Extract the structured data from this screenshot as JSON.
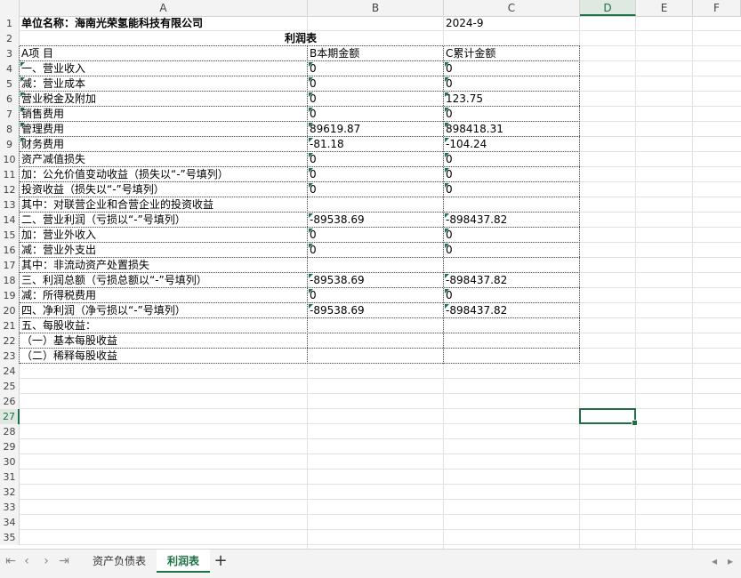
{
  "columns": [
    "A",
    "B",
    "C",
    "D",
    "E",
    "F"
  ],
  "selected_column": "D",
  "selected_row": "27",
  "rows": [
    {
      "n": "1",
      "a": "单位名称：海南光荣氢能科技有限公司",
      "b": "",
      "c": "2024-9"
    },
    {
      "n": "2",
      "title": "利润表"
    },
    {
      "n": "3",
      "a": "A项    目",
      "b": "B本期金额",
      "c": "C累计金额"
    },
    {
      "n": "4",
      "a": "一、营业收入",
      "b": "0",
      "c": "0"
    },
    {
      "n": "5",
      "a": "    减：营业成本",
      "b": "0",
      "c": "0"
    },
    {
      "n": "6",
      "a": "        营业税金及附加",
      "b": "0",
      "c": "123.75"
    },
    {
      "n": "7",
      "a": "        销售费用",
      "b": "0",
      "c": "0"
    },
    {
      "n": "8",
      "a": "        管理费用",
      "b": "89619.87",
      "c": "898418.31"
    },
    {
      "n": "9",
      "a": "        财务费用",
      "b": "-81.18",
      "c": "-104.24"
    },
    {
      "n": "10",
      "a": "        资产减值损失",
      "b": "0",
      "c": "0"
    },
    {
      "n": "11",
      "a": "        加：公允价值变动收益（损失以“-”号填列）",
      "b": "0",
      "c": "0"
    },
    {
      "n": "12",
      "a": "            投资收益（损失以“-”号填列）",
      "b": "0",
      "c": "0"
    },
    {
      "n": "13",
      "a": "            其中：对联营企业和合营企业的投资收益",
      "b": "",
      "c": ""
    },
    {
      "n": "14",
      "a": "二、营业利润（亏损以“-”号填列）",
      "b": "-89538.69",
      "c": "-898437.82"
    },
    {
      "n": "15",
      "a": "    加：营业外收入",
      "b": "0",
      "c": "0"
    },
    {
      "n": "16",
      "a": "    减：营业外支出",
      "b": "0",
      "c": "0"
    },
    {
      "n": "17",
      "a": "      其中：非流动资产处置损失",
      "b": "",
      "c": ""
    },
    {
      "n": "18",
      "a": "三、利润总额（亏损总额以“-”号填列）",
      "b": "-89538.69",
      "c": "-898437.82"
    },
    {
      "n": "19",
      "a": "    减：所得税费用",
      "b": "0",
      "c": "0"
    },
    {
      "n": "20",
      "a": "四、净利润（净亏损以“-”号填列）",
      "b": "-89538.69",
      "c": "-898437.82"
    },
    {
      "n": "21",
      "a": "五、每股收益：",
      "b": "",
      "c": ""
    },
    {
      "n": "22",
      "a": "（一）基本每股收益",
      "b": "",
      "c": ""
    },
    {
      "n": "23",
      "a": "（二）稀释每股收益",
      "b": "",
      "c": ""
    },
    {
      "n": "24"
    },
    {
      "n": "25"
    },
    {
      "n": "26"
    },
    {
      "n": "27"
    },
    {
      "n": "28"
    },
    {
      "n": "29"
    },
    {
      "n": "30"
    },
    {
      "n": "31"
    },
    {
      "n": "32"
    },
    {
      "n": "33"
    },
    {
      "n": "34"
    },
    {
      "n": "35"
    }
  ],
  "sheet_tabs": [
    {
      "label": "资产负债表",
      "active": false
    },
    {
      "label": "利润表",
      "active": true
    }
  ],
  "tabbar": {
    "first_icon": "first-sheet-icon",
    "prev_icon": "prev-sheet-icon",
    "next_icon": "next-sheet-icon",
    "last_icon": "last-sheet-icon",
    "add_label": "+"
  },
  "accent": "#1e7145"
}
